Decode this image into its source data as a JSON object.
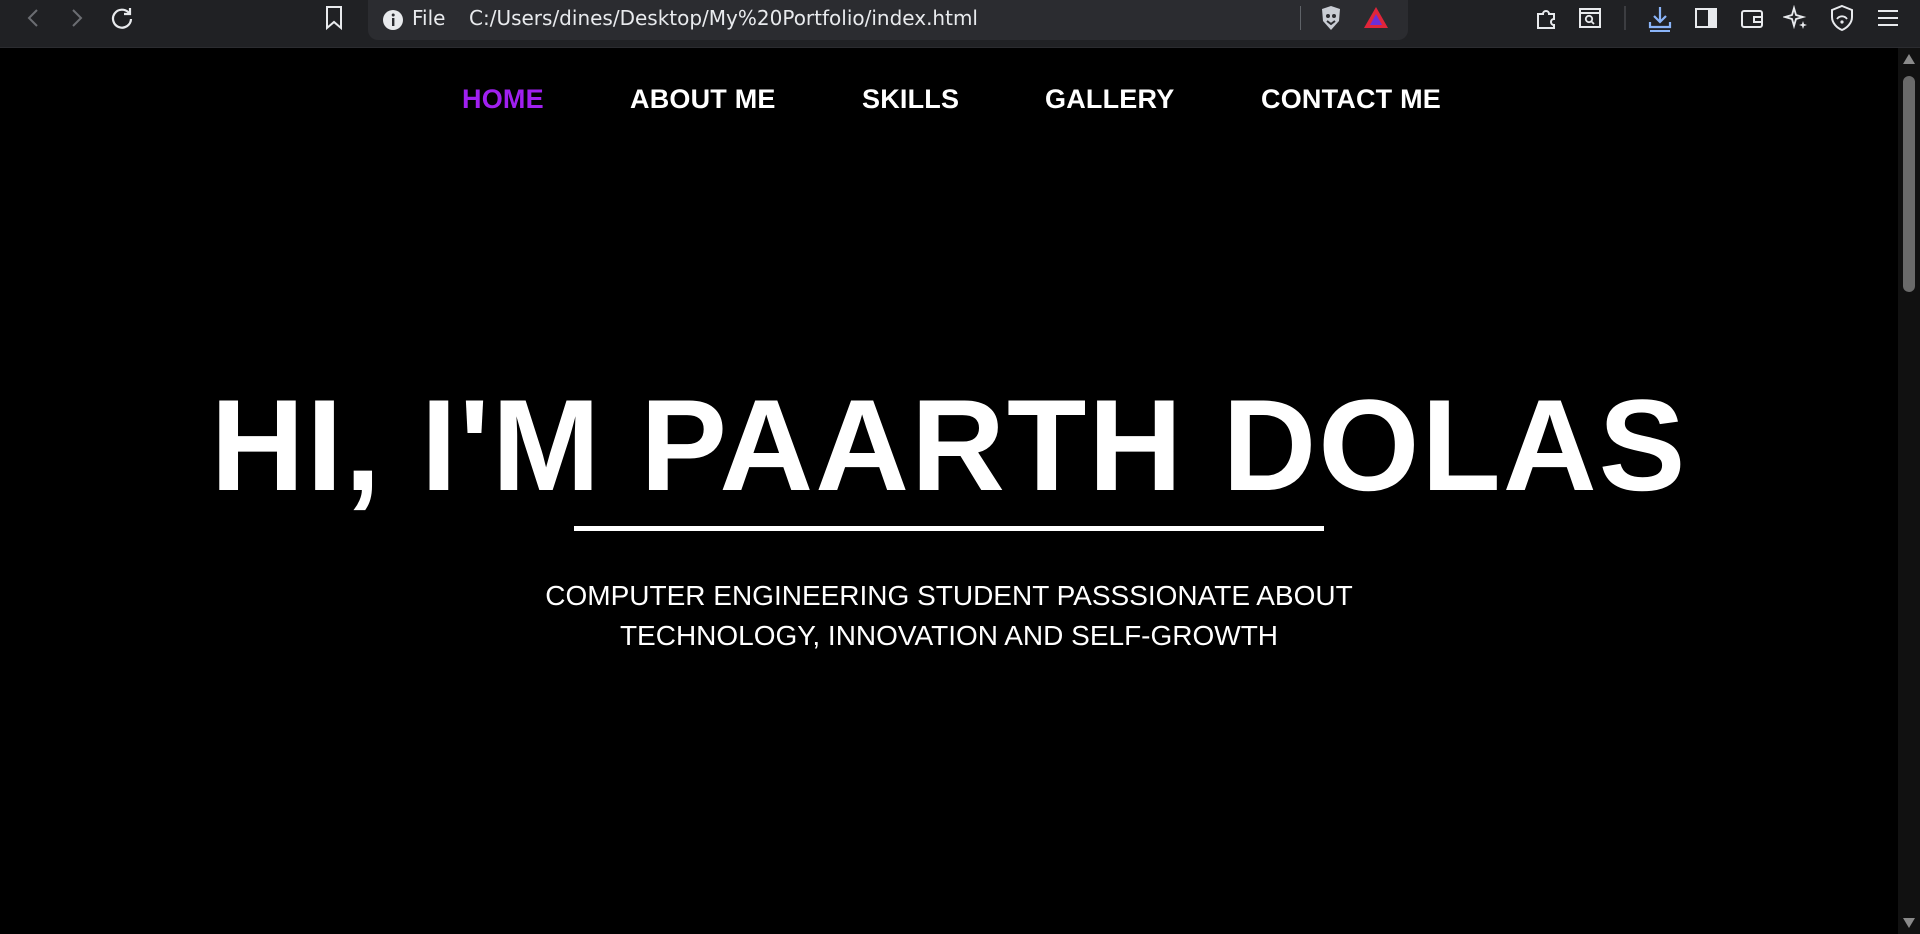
{
  "browser": {
    "address": {
      "scheme_label": "File",
      "url": "C:/Users/dines/Desktop/My%20Portfolio/index.html"
    },
    "icons": [
      "back-icon",
      "forward-icon",
      "reload-icon",
      "bookmark-icon",
      "info-icon",
      "brave-shields-icon",
      "brave-rewards-icon",
      "extensions-icon",
      "search-tab-icon",
      "downloads-icon",
      "sidebar-icon",
      "wallet-icon",
      "leo-ai-icon",
      "vpn-icon",
      "menu-icon"
    ]
  },
  "nav": {
    "items": [
      {
        "label": "HOME"
      },
      {
        "label": "ABOUT ME"
      },
      {
        "label": "SKILLS"
      },
      {
        "label": "GALLERY"
      },
      {
        "label": "CONTACT ME"
      }
    ],
    "active_color": "#a020f0"
  },
  "hero": {
    "title": "HI, I'M PAARTH DOLAS",
    "subtitle": "COMPUTER ENGINEERING STUDENT PASSSIONATE ABOUT\nTECHNOLOGY, INNOVATION AND SELF-GROWTH"
  },
  "colors": {
    "background": "#000000",
    "text": "#ffffff",
    "toolbar": "#202124"
  }
}
